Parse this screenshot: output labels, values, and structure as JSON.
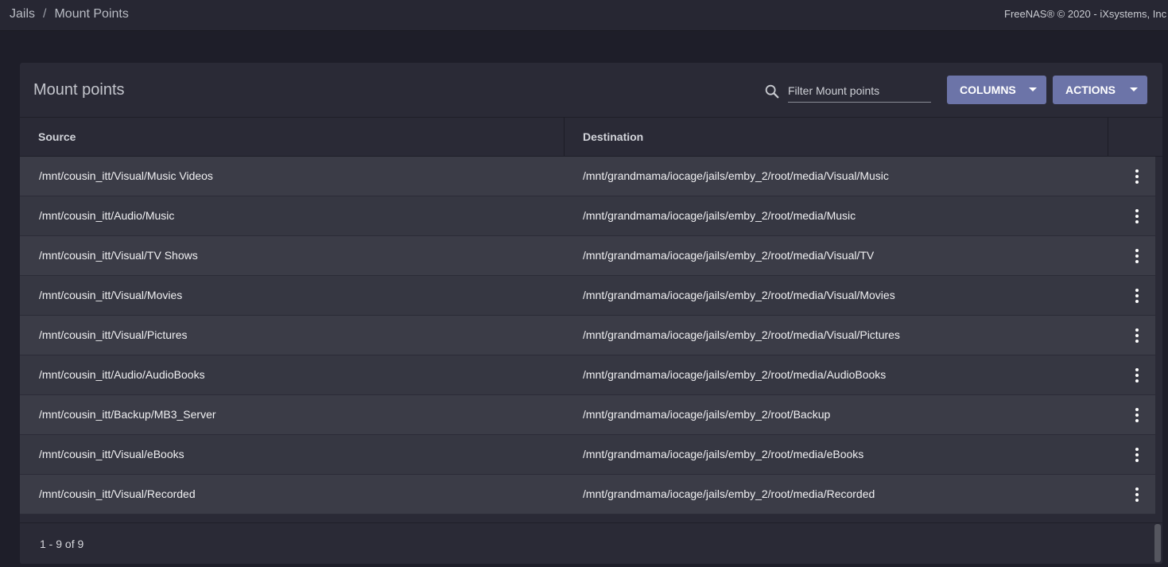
{
  "topbar": {
    "breadcrumb": [
      "Jails",
      "Mount Points"
    ],
    "separator": "/",
    "copyright": "FreeNAS® © 2020 - iXsystems, Inc"
  },
  "card": {
    "title": "Mount points",
    "filter": {
      "placeholder": "Filter Mount points",
      "value": ""
    },
    "buttons": {
      "columns": "COLUMNS",
      "actions": "ACTIONS"
    }
  },
  "icons": {
    "search": "search-icon",
    "dropdown": "caret-down-icon",
    "row_menu": "more-vert-icon"
  },
  "colors": {
    "accent": "#6c74a8",
    "background": "#1e1e29",
    "card": "#2a2a36"
  },
  "table": {
    "columns": [
      "Source",
      "Destination"
    ],
    "rows": [
      {
        "source": "/mnt/cousin_itt/Visual/Music Videos",
        "destination": "/mnt/grandmama/iocage/jails/emby_2/root/media/Visual/Music"
      },
      {
        "source": "/mnt/cousin_itt/Audio/Music",
        "destination": "/mnt/grandmama/iocage/jails/emby_2/root/media/Music"
      },
      {
        "source": "/mnt/cousin_itt/Visual/TV Shows",
        "destination": "/mnt/grandmama/iocage/jails/emby_2/root/media/Visual/TV"
      },
      {
        "source": "/mnt/cousin_itt/Visual/Movies",
        "destination": "/mnt/grandmama/iocage/jails/emby_2/root/media/Visual/Movies"
      },
      {
        "source": "/mnt/cousin_itt/Visual/Pictures",
        "destination": "/mnt/grandmama/iocage/jails/emby_2/root/media/Visual/Pictures"
      },
      {
        "source": "/mnt/cousin_itt/Audio/AudioBooks",
        "destination": "/mnt/grandmama/iocage/jails/emby_2/root/media/AudioBooks"
      },
      {
        "source": "/mnt/cousin_itt/Backup/MB3_Server",
        "destination": "/mnt/grandmama/iocage/jails/emby_2/root/Backup"
      },
      {
        "source": "/mnt/cousin_itt/Visual/eBooks",
        "destination": "/mnt/grandmama/iocage/jails/emby_2/root/media/eBooks"
      },
      {
        "source": "/mnt/cousin_itt/Visual/Recorded",
        "destination": "/mnt/grandmama/iocage/jails/emby_2/root/media/Recorded"
      }
    ]
  },
  "pagination": {
    "range": "1 - 9 of 9"
  }
}
